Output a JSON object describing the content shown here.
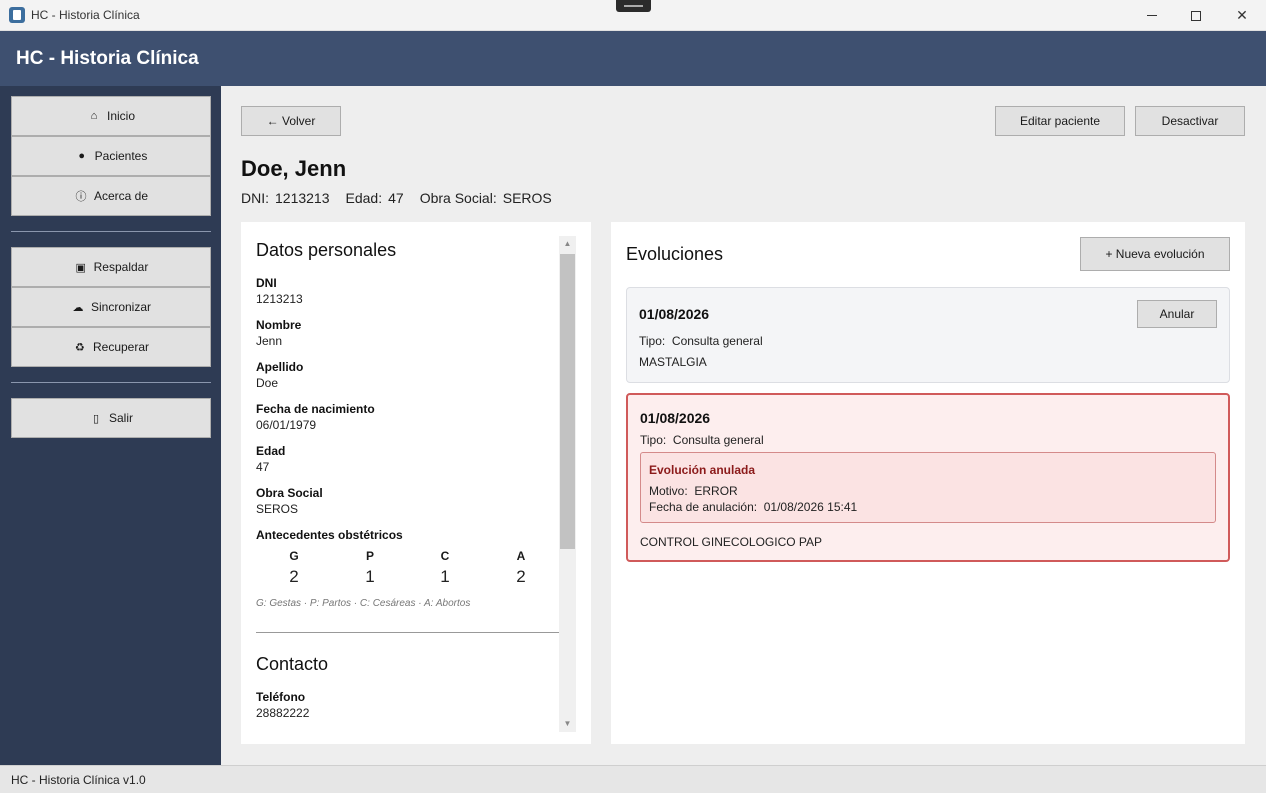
{
  "window": {
    "title": "HC - Historia Clínica"
  },
  "app": {
    "title": "HC - Historia Clínica"
  },
  "sidebar": {
    "items": [
      {
        "label": "Inicio",
        "icon": "home-icon"
      },
      {
        "label": "Pacientes",
        "icon": "person-icon"
      },
      {
        "label": "Acerca de",
        "icon": "info-icon"
      },
      {
        "label": "Respaldar",
        "icon": "save-icon"
      },
      {
        "label": "Sincronizar",
        "icon": "cloud-icon"
      },
      {
        "label": "Recuperar",
        "icon": "recycle-icon"
      },
      {
        "label": "Salir",
        "icon": "exit-icon"
      }
    ]
  },
  "toolbar": {
    "back_label": "← Volver",
    "edit_label": "Editar paciente",
    "deactivate_label": "Desactivar"
  },
  "patient": {
    "name": "Doe, Jenn",
    "dni_label": "DNI:",
    "dni": "1213213",
    "age_label": "Edad:",
    "age": "47",
    "insurance_label": "Obra Social:",
    "insurance": "SEROS"
  },
  "personal": {
    "title": "Datos personales",
    "fields": [
      {
        "label": "DNI",
        "value": "1213213"
      },
      {
        "label": "Nombre",
        "value": "Jenn"
      },
      {
        "label": "Apellido",
        "value": "Doe"
      },
      {
        "label": "Fecha de nacimiento",
        "value": "06/01/1979"
      },
      {
        "label": "Edad",
        "value": "47"
      },
      {
        "label": "Obra Social",
        "value": "SEROS"
      }
    ],
    "obstetric": {
      "label": "Antecedentes obstétricos",
      "headers": [
        "G",
        "P",
        "C",
        "A"
      ],
      "values": [
        "2",
        "1",
        "1",
        "2"
      ],
      "note": "G: Gestas · P: Partos · C: Cesáreas · A: Abortos"
    }
  },
  "contact": {
    "title": "Contacto",
    "phone_label": "Teléfono",
    "phone": "28882222"
  },
  "evolutions": {
    "title": "Evoluciones",
    "new_label": "+ Nueva evolución",
    "items": [
      {
        "date": "01/08/2026",
        "type_label": "Tipo:",
        "type": "Consulta general",
        "text": "MASTALGIA",
        "annul_label": "Anular"
      },
      {
        "date": "01/08/2026",
        "type_label": "Tipo:",
        "type": "Consulta general",
        "annulled_title": "Evolución anulada",
        "reason_label": "Motivo:",
        "reason": "ERROR",
        "annul_date_label": "Fecha de anulación:",
        "annul_date": "01/08/2026 15:41",
        "text": "CONTROL GINECOLOGICO PAP"
      }
    ]
  },
  "status": {
    "text": "HC - Historia Clínica v1.0"
  },
  "colors": {
    "header": "#3e5070",
    "sidebar": "#2e3b54",
    "annulled_border": "#d05a5a",
    "annulled_title": "#8b1a1a"
  }
}
